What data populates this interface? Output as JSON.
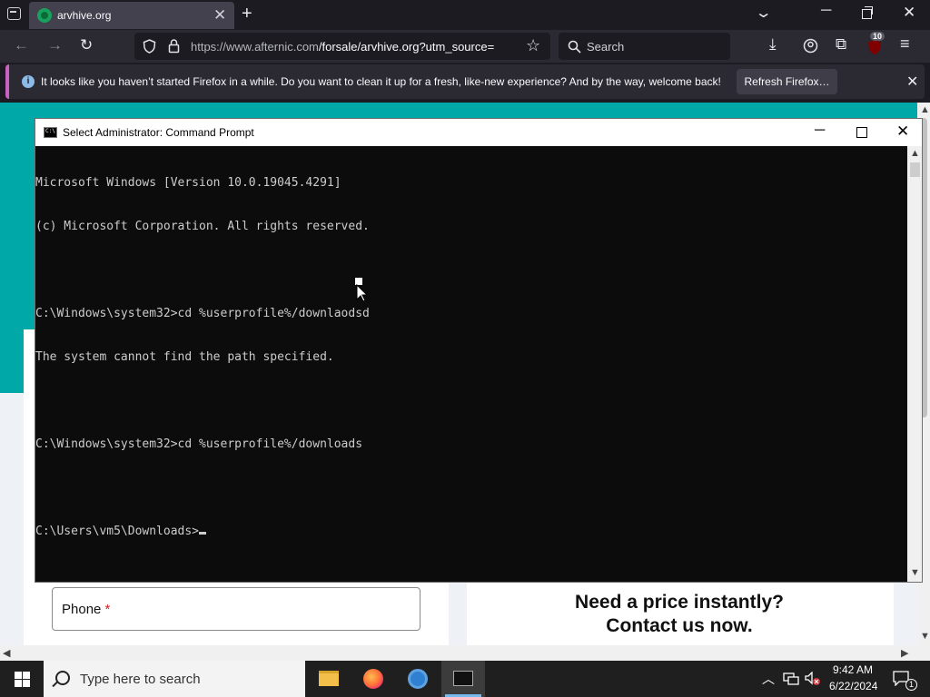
{
  "browser": {
    "tab_title": "arvhive.org",
    "url_host": "https://www.afternic.com",
    "url_rest": "/forsale/arvhive.org?utm_source=",
    "search_placeholder": "Search",
    "extension_badge": "10",
    "notification_text": "It looks like you haven’t started Firefox in a while. Do you want to clean it up for a fresh, like-new experience? And by the way, welcome back!",
    "notification_button": "Refresh Firefox…"
  },
  "webpage": {
    "phone_label": "Phone",
    "required_mark": "*",
    "price_heading_line1": "Need a price instantly?",
    "price_heading_line2": "Contact us now."
  },
  "cmd": {
    "title": "Select Administrator: Command Prompt",
    "lines": [
      "Microsoft Windows [Version 10.0.19045.4291]",
      "(c) Microsoft Corporation. All rights reserved.",
      "",
      "C:\\Windows\\system32>cd %userprofile%/downlaodsd",
      "The system cannot find the path specified.",
      "",
      "C:\\Windows\\system32>cd %userprofile%/downloads",
      "",
      "C:\\Users\\vm5\\Downloads>"
    ]
  },
  "taskbar": {
    "search_placeholder": "Type here to search",
    "time": "9:42 AM",
    "date": "6/22/2024",
    "notification_count": "1"
  }
}
